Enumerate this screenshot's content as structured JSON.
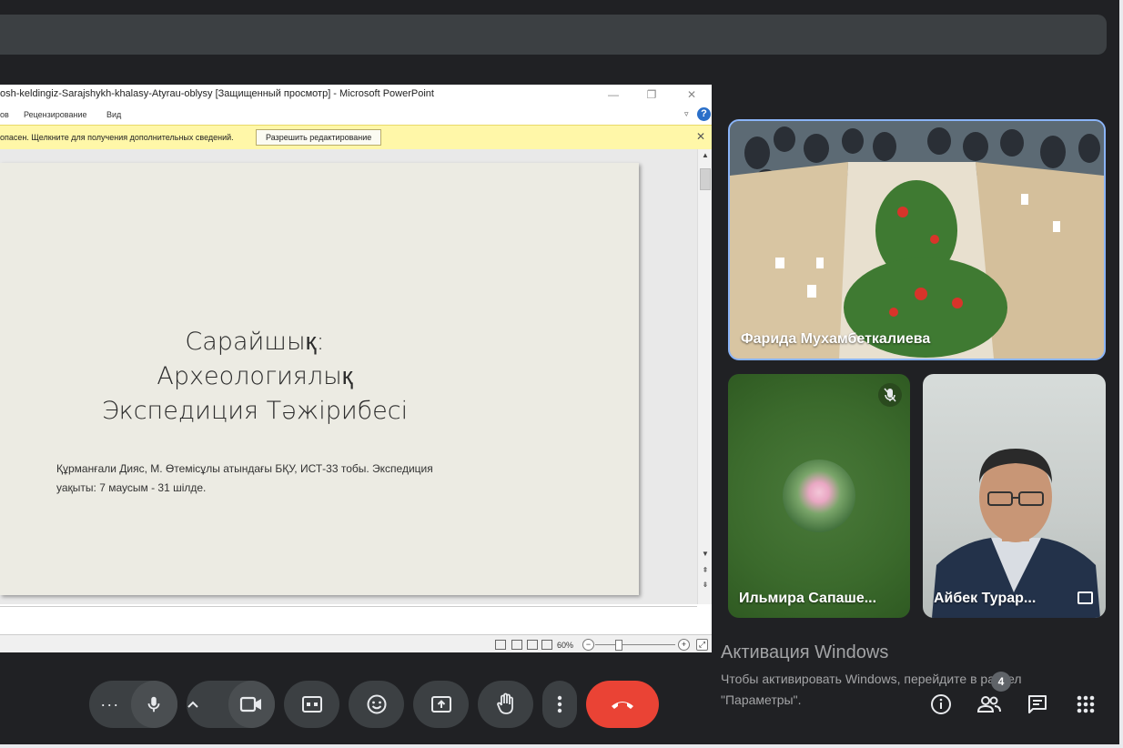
{
  "powerpoint": {
    "window_title": "osh-keldingiz-Sarajshykh-khalasy-Atyrau-oblysy [Защищенный просмотр] - Microsoft PowerPoint",
    "menu": [
      "ов",
      "Рецензирование",
      "Вид"
    ],
    "message": "опасен. Щелкните для получения дополнительных сведений.",
    "enable_editing_label": "Разрешить редактирование",
    "zoom_level": "60%",
    "slide": {
      "title_lines": [
        "Сарайшық:",
        "Археологиялық",
        "Экспедиция Тәжірибесі"
      ],
      "subtitle_lines": [
        "Құрманғали Дияс, М. Өтемісұлы атындағы БҚУ, ИСТ-33 тобы. Экспедиция",
        "уақыты: 7 маусым - 31 шілде."
      ]
    }
  },
  "participants": [
    {
      "name": "Фарида Мухамбеткалиева"
    },
    {
      "name": "Ильмира Сапаше..."
    },
    {
      "name": "Айбек Турар..."
    }
  ],
  "windows_activation": {
    "title": "Активация Windows",
    "subtitle": "Чтобы активировать Windows, перейдите в раздел \"Параметры\"."
  },
  "people_count": "4",
  "colors": {
    "leave": "#ea4335",
    "accent": "#8ab4f8",
    "control_bg": "#3c4043"
  },
  "icons": [
    "more-options-icon",
    "microphone-icon",
    "chevron-up-icon",
    "camera-icon",
    "captions-icon",
    "emoji-icon",
    "present-screen-icon",
    "raise-hand-icon",
    "more-vert-icon",
    "hang-up-icon",
    "info-icon",
    "people-icon",
    "chat-icon",
    "activities-icon"
  ]
}
